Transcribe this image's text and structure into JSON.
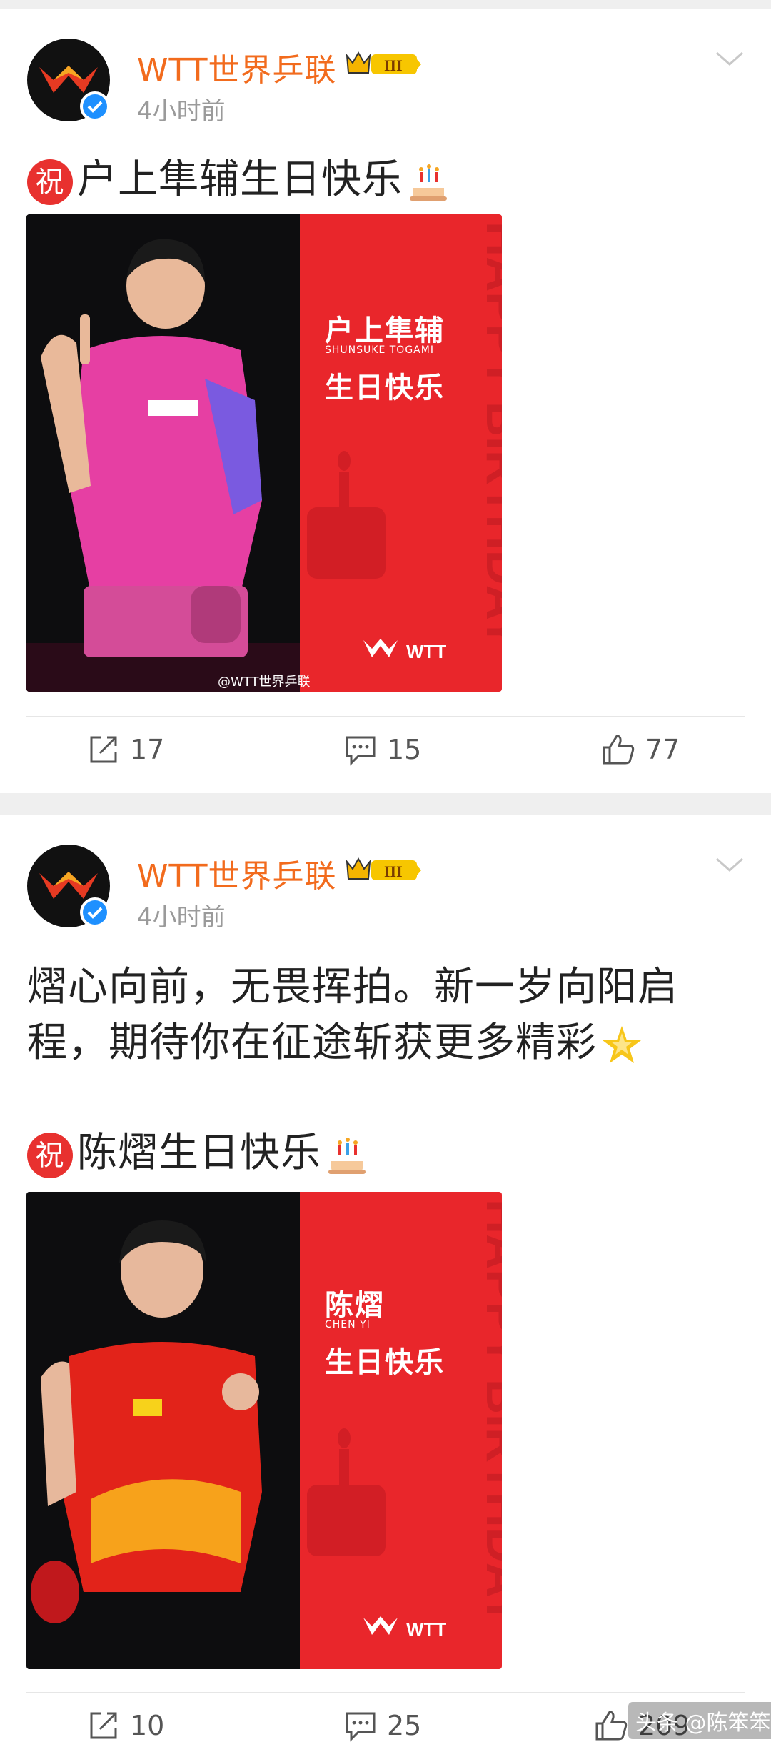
{
  "posts": [
    {
      "author": "WTT世界乒联",
      "badge_level": "III",
      "time": "4小时前",
      "text_lines": [],
      "greeting": "户上隼辅生日快乐",
      "zhu_char": "祝",
      "card": {
        "player_cn": "户上隼辅",
        "player_en": "SHUNSUKE TOGAMI",
        "birthday_cn": "生日快乐",
        "side_text": "HAPPY BIRTHDAY",
        "logo_text": "WTT",
        "watermark": "@WTT世界乒联"
      },
      "actions": {
        "share": "17",
        "comment": "15",
        "like": "77"
      }
    },
    {
      "author": "WTT世界乒联",
      "badge_level": "III",
      "time": "4小时前",
      "text_lines": [
        "熠心向前，无畏挥拍。新一岁向阳启",
        "程，期待你在征途斩获更多精彩"
      ],
      "greeting": "陈熠生日快乐",
      "zhu_char": "祝",
      "card": {
        "player_cn": "陈熠",
        "player_en": "CHEN YI",
        "birthday_cn": "生日快乐",
        "side_text": "HAPPY BIRTHDAY",
        "logo_text": "WTT",
        "watermark": ""
      },
      "actions": {
        "share": "10",
        "comment": "25",
        "like": "209"
      }
    }
  ],
  "source_watermark": "头条 @陈笨笨",
  "colors": {
    "accent_orange": "#f26b1d",
    "card_red": "#e9262b",
    "verified_blue": "#1e90ff"
  }
}
